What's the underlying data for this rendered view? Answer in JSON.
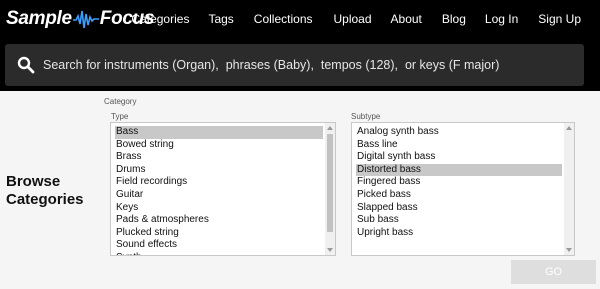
{
  "header": {
    "logo_left": "Sample",
    "logo_right": "Focus",
    "nav": [
      "Categories",
      "Tags",
      "Collections",
      "Upload",
      "About",
      "Blog",
      "Log In",
      "Sign Up"
    ]
  },
  "search": {
    "placeholder": "Search for instruments (Organ),  phrases (Baby),  tempos (128),  or keys (F major)"
  },
  "main": {
    "title_line1": "Browse",
    "title_line2": "Categories",
    "category_label": "Category",
    "type_label": "Type",
    "subtype_label": "Subtype",
    "types": [
      "Bass",
      "Bowed string",
      "Brass",
      "Drums",
      "Field recordings",
      "Guitar",
      "Keys",
      "Pads & atmospheres",
      "Plucked string",
      "Sound effects",
      "Synth"
    ],
    "selected_type": "Bass",
    "subtypes": [
      "Analog synth bass",
      "Bass line",
      "Digital synth bass",
      "Distorted bass",
      "Fingered bass",
      "Picked bass",
      "Slapped bass",
      "Sub bass",
      "Upright bass"
    ],
    "selected_subtype": "Distorted bass",
    "go_label": "GO"
  },
  "colors": {
    "header_bg": "#000000",
    "search_bg": "#2b2b2b",
    "selected_bg": "#c8c8c8",
    "go_bg": "#dedede"
  }
}
